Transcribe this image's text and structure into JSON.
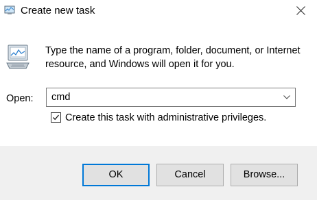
{
  "window": {
    "title": "Create new task",
    "icon": "run-dialog-icon"
  },
  "description": "Type the name of a program, folder, document, or Internet resource, and Windows will open it for you.",
  "open_field": {
    "label": "Open:",
    "value": "cmd"
  },
  "admin_checkbox": {
    "label": "Create this task with administrative privileges.",
    "checked": true
  },
  "buttons": {
    "ok": "OK",
    "cancel": "Cancel",
    "browse": "Browse..."
  },
  "colors": {
    "accent": "#0078d7",
    "footer_bg": "#f0f0f0",
    "button_bg": "#e1e1e1"
  }
}
